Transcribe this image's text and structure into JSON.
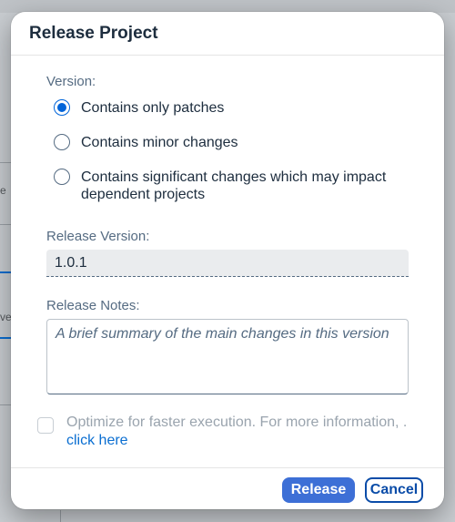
{
  "background": {
    "fragment_text_1": "e",
    "fragment_text_2": "ver"
  },
  "dialog": {
    "title": "Release Project",
    "version_label": "Version:",
    "options": [
      {
        "label": "Contains only patches",
        "selected": true
      },
      {
        "label": "Contains minor changes",
        "selected": false
      },
      {
        "label": "Contains significant changes which may impact dependent projects",
        "selected": false
      }
    ],
    "release_version_label": "Release Version:",
    "release_version_value": "1.0.1",
    "release_notes_label": "Release Notes:",
    "release_notes_placeholder": "A brief summary of the main changes in this version",
    "optimize_text": "Optimize for faster execution. For more information, .",
    "optimize_link": "click here",
    "optimize_checked": false,
    "release_button": "Release",
    "cancel_button": "Cancel"
  },
  "colors": {
    "accent": "#0064d9",
    "primary_button": "#3d6fd6",
    "link": "#0a6ed1"
  }
}
